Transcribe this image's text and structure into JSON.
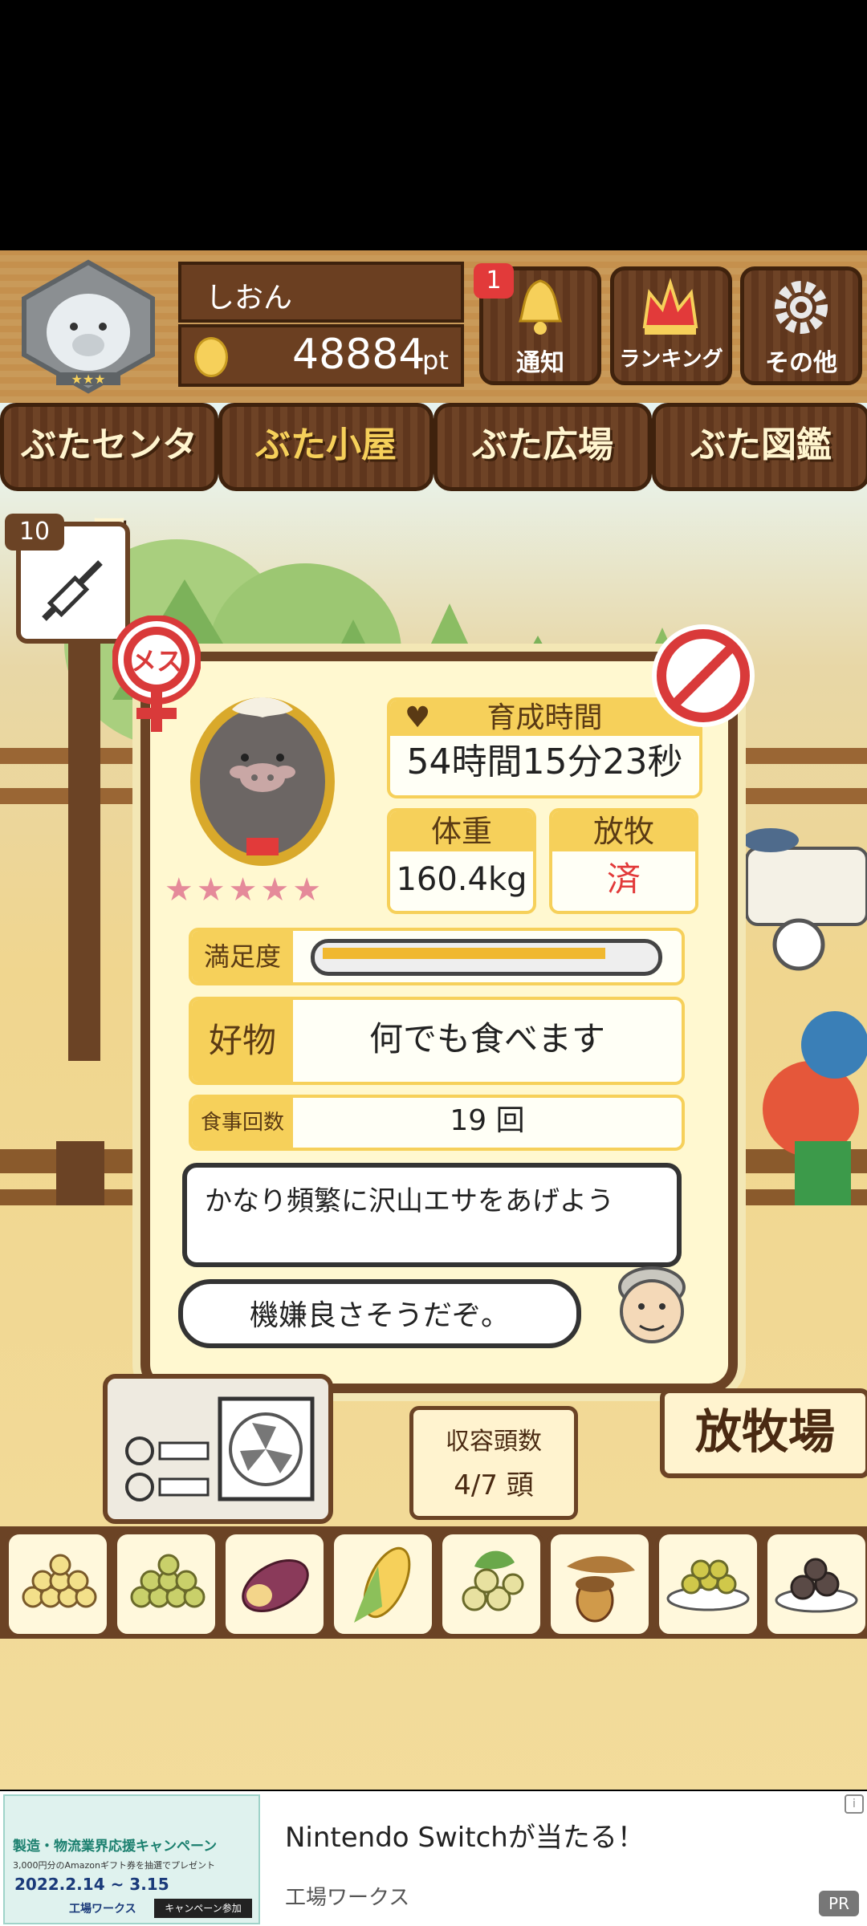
{
  "header": {
    "player_name": "しおん",
    "points": "48884",
    "points_unit": "pt",
    "notification_badge": "1",
    "buttons": [
      "通知",
      "ランキング",
      "その他"
    ]
  },
  "tabs": [
    {
      "label": "ぶたセンター",
      "active": false
    },
    {
      "label": "ぶた小屋",
      "active": true
    },
    {
      "label": "ぶた広場",
      "active": false
    },
    {
      "label": "ぶた図鑑",
      "active": false
    }
  ],
  "syringe_count": "10",
  "gender_label": "メス",
  "pig": {
    "stars": "★★★★★",
    "growth_time_label": "育成時間",
    "growth_time": "54時間15分23秒",
    "weight_label": "体重",
    "weight": "160.4kg",
    "grazing_label": "放牧",
    "grazing": "済",
    "satisfaction_label": "満足度",
    "satisfaction": 0.88,
    "favorite_label": "好物",
    "favorite": "何でも食べます",
    "meals_label": "食事回数",
    "meals": "19 回",
    "advice": "かなり頻繁に沢山エサをあげよう",
    "mood": "機嫌良さそうだぞ。"
  },
  "capacity": {
    "label": "収容頭数",
    "value": "4/7 頭"
  },
  "pasture_label": "放牧場",
  "feeds": [
    "feed-1",
    "feed-2",
    "feed-3",
    "feed-4",
    "feed-5",
    "feed-6",
    "feed-7",
    "feed-8"
  ],
  "ad": {
    "title": "Nintendo Switchが当たる！",
    "advertiser": "工場ワークス",
    "pr": "PR",
    "banner_campaign": "製造・物流業界応援キャンペーン",
    "banner_date": "2022.2.14",
    "banner_date_end": "3.15",
    "banner_gift": "3,000円分のAmazonギフト券を抽選でプレゼント",
    "banner_brand": "工場ワークス",
    "banner_button": "キャンペーン参加"
  },
  "colors": {
    "accent": "#f6d05a",
    "wood": "#6b4325",
    "red": "#e23a3a"
  }
}
